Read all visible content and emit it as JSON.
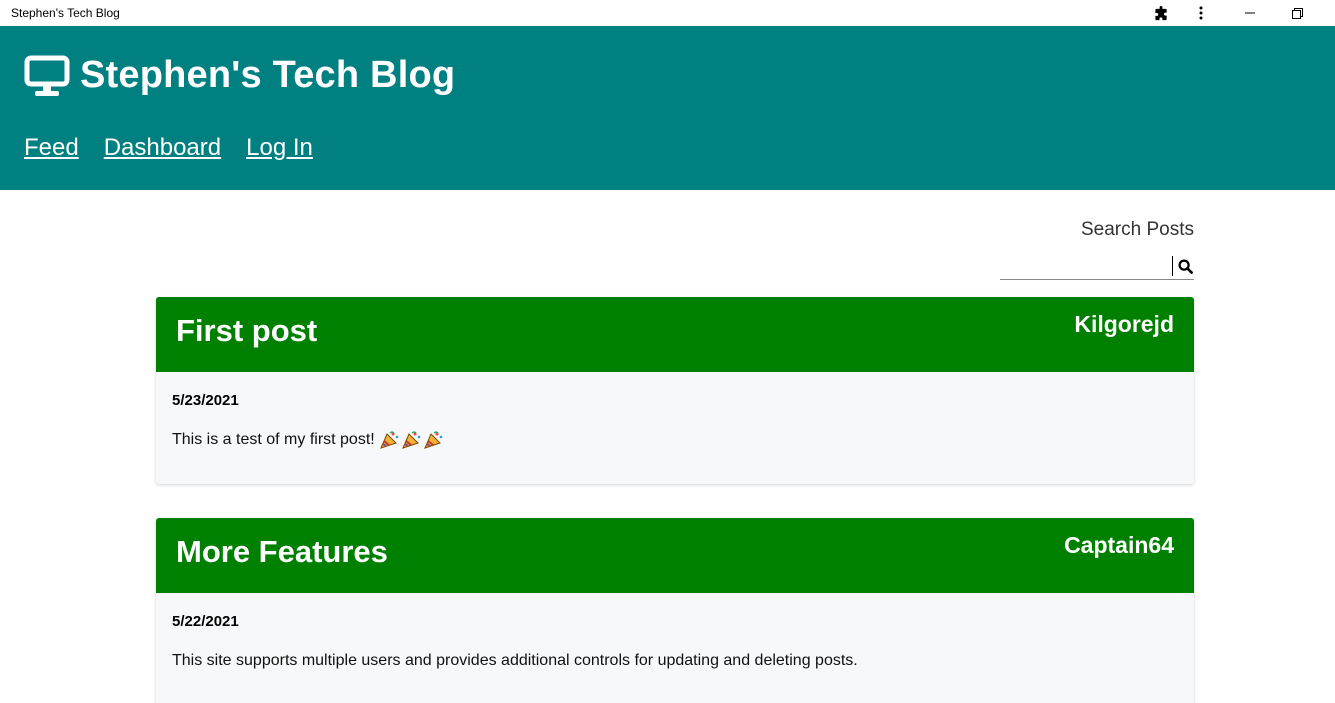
{
  "window": {
    "title": "Stephen's Tech Blog"
  },
  "header": {
    "brand_icon": "monitor-icon",
    "site_title": "Stephen's Tech Blog",
    "nav": [
      {
        "label": "Feed"
      },
      {
        "label": "Dashboard"
      },
      {
        "label": "Log In"
      }
    ]
  },
  "search": {
    "label": "Search Posts",
    "value": "",
    "placeholder": "",
    "icon": "search-icon"
  },
  "posts": [
    {
      "title": "First post",
      "author": "Kilgorejd",
      "date": "5/23/2021",
      "body": "This is a test of my first post!",
      "emoji_count": 3,
      "emoji": "party-popper-icon"
    },
    {
      "title": "More Features",
      "author": "Captain64",
      "date": "5/22/2021",
      "body": "This site supports multiple users and provides additional controls for updating and deleting posts."
    }
  ],
  "colors": {
    "header_bg": "#008080",
    "post_header_bg": "#008000",
    "post_body_bg": "#f7f8f9",
    "text_light": "#ffffff"
  }
}
